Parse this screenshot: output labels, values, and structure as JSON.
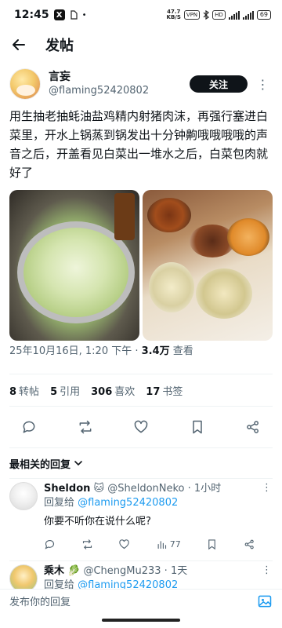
{
  "status_bar": {
    "time": "12:45",
    "app_badge": "X",
    "speed_top": "47.7",
    "speed_bottom": "KB/S",
    "vpn": "VPN",
    "hd": "HD",
    "battery": "69"
  },
  "nav": {
    "title": "发帖"
  },
  "post": {
    "author_name": "言妄",
    "author_handle": "@flaming52420802",
    "follow_label": "关注",
    "text": "用生抽老抽蚝油盐鸡精内射猪肉沫，再强行塞进白菜里，开水上锅蒸到锅发出十分钟齁哦哦哦哦的声音之后，开盖看见白菜出一堆水之后，白菜包肉就好了",
    "timestamp": "25年10月16日, 1:20 下午 · ",
    "views_count": "3.4万",
    "views_label": " 查看"
  },
  "stats": [
    {
      "count": "8",
      "label": "转帖"
    },
    {
      "count": "5",
      "label": "引用"
    },
    {
      "count": "306",
      "label": "喜欢"
    },
    {
      "count": "17",
      "label": "书签"
    }
  ],
  "sort_label": "最相关的回复",
  "replies": [
    {
      "name": "Sheldon",
      "handle_time": " @SheldonNeko · 1小时",
      "reply_prefix": "回复给 ",
      "reply_to": "@flaming52420802",
      "text": "你要不听你在说什么呢?",
      "views": "77"
    },
    {
      "name": "乘木",
      "handle_time": " @ChengMu233 · 1天",
      "reply_prefix": "回复给 ",
      "reply_to": "@flaming52420802"
    }
  ],
  "compose": {
    "placeholder": "发布你的回复"
  },
  "icons": {
    "back": "arrow-left-icon",
    "more": "more-horizontal-icon",
    "reply": "comment-icon",
    "retweet": "repost-icon",
    "like": "heart-icon",
    "bookmark": "bookmark-icon",
    "share": "share-icon",
    "image": "image-icon"
  }
}
